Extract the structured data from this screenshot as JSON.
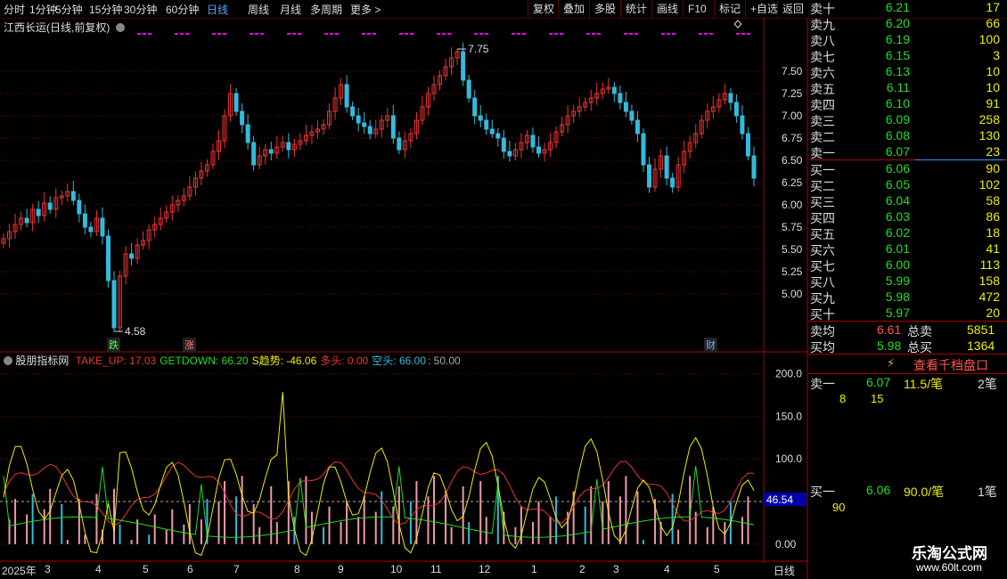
{
  "toolbar": {
    "tabs": [
      "分时",
      "1分钟",
      "5分钟",
      "15分钟",
      "30分钟",
      "60分钟",
      "日线",
      "周线",
      "月线",
      "多周期",
      "更多 >"
    ],
    "right_buttons": [
      "复权",
      "叠加",
      "多股",
      "统计",
      "画线",
      "F10",
      "标记",
      "+自选",
      "返回"
    ]
  },
  "main_chart": {
    "title": "江西长运(日线,前复权)",
    "price_labels": [
      "7.50",
      "7.25",
      "7.00",
      "6.75",
      "6.50",
      "6.25",
      "6.00",
      "5.75",
      "5.50",
      "5.25",
      "5.00"
    ],
    "high_label": "7.75",
    "low_label": "4.58",
    "markers": {
      "die": "跌",
      "zhang": "涨",
      "cai": "财"
    }
  },
  "chart_data": {
    "type": "candlestick",
    "ylim": [
      4.5,
      7.9
    ],
    "closes": [
      5.62,
      5.7,
      5.78,
      5.85,
      5.8,
      5.95,
      5.88,
      6.02,
      5.95,
      6.08,
      6.1,
      6.15,
      6.05,
      5.9,
      5.75,
      5.7,
      5.85,
      5.65,
      5.15,
      4.62,
      5.2,
      5.45,
      5.4,
      5.55,
      5.6,
      5.72,
      5.78,
      5.85,
      5.92,
      6.0,
      6.05,
      6.1,
      6.2,
      6.3,
      6.38,
      6.45,
      6.6,
      6.72,
      7.0,
      7.25,
      7.05,
      6.9,
      6.7,
      6.45,
      6.55,
      6.62,
      6.58,
      6.65,
      6.7,
      6.62,
      6.68,
      6.72,
      6.78,
      6.82,
      6.85,
      6.9,
      7.05,
      7.2,
      7.35,
      7.1,
      7.0,
      6.92,
      6.88,
      6.8,
      6.85,
      6.95,
      7.0,
      6.75,
      6.62,
      6.72,
      6.8,
      6.95,
      7.1,
      7.25,
      7.35,
      7.45,
      7.55,
      7.65,
      7.72,
      7.4,
      7.2,
      7.0,
      6.95,
      6.85,
      6.8,
      6.75,
      6.6,
      6.55,
      6.62,
      6.7,
      6.78,
      6.65,
      6.58,
      6.62,
      6.7,
      6.82,
      6.9,
      7.0,
      7.05,
      7.1,
      7.15,
      7.2,
      7.25,
      7.3,
      7.32,
      7.25,
      7.15,
      7.05,
      6.95,
      6.8,
      6.45,
      6.2,
      6.4,
      6.55,
      6.3,
      6.2,
      6.45,
      6.6,
      6.7,
      6.8,
      6.95,
      7.05,
      7.1,
      7.18,
      7.25,
      7.15,
      7.0,
      6.8,
      6.55,
      6.3
    ],
    "indicator": {
      "name": "股朋指标网",
      "series": [
        {
          "name": "TAKE_UP",
          "value": "17.03",
          "color": "#e33"
        },
        {
          "name": "GETDOWN",
          "value": "66.20",
          "color": "#2d2"
        },
        {
          "name": "S趋势",
          "value": "-46.06",
          "color": "#ee0"
        },
        {
          "name": "多头",
          "value": "0.00",
          "color": "#e33"
        },
        {
          "name": "空头",
          "value": "66.00",
          "color": "#3bd"
        }
      ],
      "extra": ": 50.00",
      "y_labels": [
        "200.0",
        "150.0",
        "100.0",
        "50.00",
        "0.00"
      ],
      "current_value": "46.54"
    }
  },
  "x_axis": {
    "dates": [
      "2025年",
      "3",
      "4",
      "5",
      "6",
      "7",
      "8",
      "9",
      "10",
      "11",
      "12",
      "1",
      "2",
      "3",
      "4",
      "5"
    ],
    "period": "日线"
  },
  "order_book": {
    "sell": [
      {
        "label": "卖十",
        "price": "6.21",
        "vol": "17"
      },
      {
        "label": "卖九",
        "price": "6.20",
        "vol": "66"
      },
      {
        "label": "卖八",
        "price": "6.19",
        "vol": "100"
      },
      {
        "label": "卖七",
        "price": "6.15",
        "vol": "3"
      },
      {
        "label": "卖六",
        "price": "6.13",
        "vol": "10"
      },
      {
        "label": "卖五",
        "price": "6.11",
        "vol": "10"
      },
      {
        "label": "卖四",
        "price": "6.10",
        "vol": "91"
      },
      {
        "label": "卖三",
        "price": "6.09",
        "vol": "258"
      },
      {
        "label": "卖二",
        "price": "6.08",
        "vol": "130"
      },
      {
        "label": "卖一",
        "price": "6.07",
        "vol": "23"
      }
    ],
    "buy": [
      {
        "label": "买一",
        "price": "6.06",
        "vol": "90"
      },
      {
        "label": "买二",
        "price": "6.05",
        "vol": "102"
      },
      {
        "label": "买三",
        "price": "6.04",
        "vol": "58"
      },
      {
        "label": "买四",
        "price": "6.03",
        "vol": "86"
      },
      {
        "label": "买五",
        "price": "6.02",
        "vol": "18"
      },
      {
        "label": "买六",
        "price": "6.01",
        "vol": "41"
      },
      {
        "label": "买七",
        "price": "6.00",
        "vol": "113"
      },
      {
        "label": "买八",
        "price": "5.99",
        "vol": "158"
      },
      {
        "label": "买九",
        "price": "5.98",
        "vol": "472"
      },
      {
        "label": "买十",
        "price": "5.97",
        "vol": "20"
      }
    ],
    "avg_sell_label": "卖均",
    "avg_sell": "6.61",
    "total_sell_label": "总卖",
    "total_sell": "5851",
    "avg_buy_label": "买均",
    "avg_buy": "5.98",
    "total_buy_label": "总买",
    "total_buy": "1364",
    "view_button": "查看千档盘口",
    "sell1_label": "卖一",
    "sell1_price": "6.07",
    "sell1_avg": "11.5/笔",
    "sell1_count": "2笔",
    "sell1_q1": "8",
    "sell1_q2": "15",
    "buy1_label": "买一",
    "buy1_price": "6.06",
    "buy1_avg": "90.0/笔",
    "buy1_count": "1笔",
    "buy1_q1": "90"
  },
  "watermark": {
    "title": "乐淘公式网",
    "url": "www.60lt.com"
  },
  "colors": {
    "up": "#e33",
    "down": "#3bd",
    "grid": "#7a0000",
    "bg": "#000000"
  }
}
